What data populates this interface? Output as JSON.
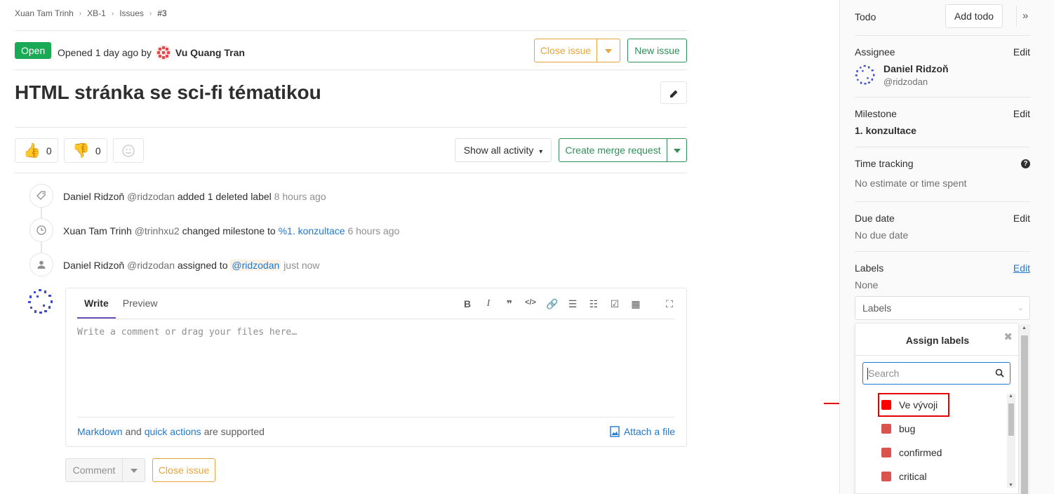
{
  "breadcrumb": [
    "Xuan Tam Trinh",
    "XB-1",
    "Issues",
    "#3"
  ],
  "issue": {
    "status": "Open",
    "opened_text": "Opened 1 day ago by",
    "author": "Vu Quang Tran",
    "title": "HTML stránka se sci-fi tématikou"
  },
  "header_buttons": {
    "close_issue": "Close issue",
    "new_issue": "New issue"
  },
  "awards": {
    "thumbsup_count": "0",
    "thumbsdown_count": "0"
  },
  "activity_filter": "Show all activity",
  "create_merge_request": "Create merge request",
  "timeline": [
    {
      "actor": "Daniel Ridzoň",
      "handle": "@ridzodan",
      "action": "added 1 deleted label",
      "link": "",
      "time": "8 hours ago",
      "icon": "tag-icon"
    },
    {
      "actor": "Xuan Tam Trinh",
      "handle": "@trinhxu2",
      "action": "changed milestone to",
      "link": "%1. konzultace",
      "time": "6 hours ago",
      "icon": "clock-icon"
    },
    {
      "actor": "Daniel Ridzoň",
      "handle": "@ridzodan",
      "action": "assigned to",
      "link": "@ridzodan",
      "time": "just now",
      "icon": "user-icon"
    }
  ],
  "comment": {
    "tab_write": "Write",
    "tab_preview": "Preview",
    "placeholder": "Write a comment or drag your files here…",
    "markdown_link": "Markdown",
    "and_text": "and",
    "quick_actions_link": "quick actions",
    "supported_text": "are supported",
    "attach": "Attach a file",
    "comment_button": "Comment",
    "close_issue_button": "Close issue"
  },
  "sidebar": {
    "todo_title": "Todo",
    "add_todo": "Add todo",
    "assignee_title": "Assignee",
    "edit": "Edit",
    "assignee_name": "Daniel Ridzoň",
    "assignee_handle": "@ridzodan",
    "milestone_title": "Milestone",
    "milestone_value": "1. konzultace",
    "time_tracking_title": "Time tracking",
    "time_tracking_value": "No estimate or time spent",
    "due_date_title": "Due date",
    "due_date_value": "No due date",
    "labels_title": "Labels",
    "labels_value": "None",
    "labels_dropdown": "Labels",
    "assign_labels_title": "Assign labels",
    "search_placeholder": "Search",
    "labels": [
      {
        "name": "Ve vývoji",
        "color": "#ff0000"
      },
      {
        "name": "bug",
        "color": "#d9534f"
      },
      {
        "name": "confirmed",
        "color": "#d9534f"
      },
      {
        "name": "critical",
        "color": "#d9534f"
      }
    ]
  },
  "colors": {
    "open_green": "#1aaa55",
    "warning": "#e7a43b",
    "success": "#2d8f57",
    "highlight": "#e60000"
  }
}
